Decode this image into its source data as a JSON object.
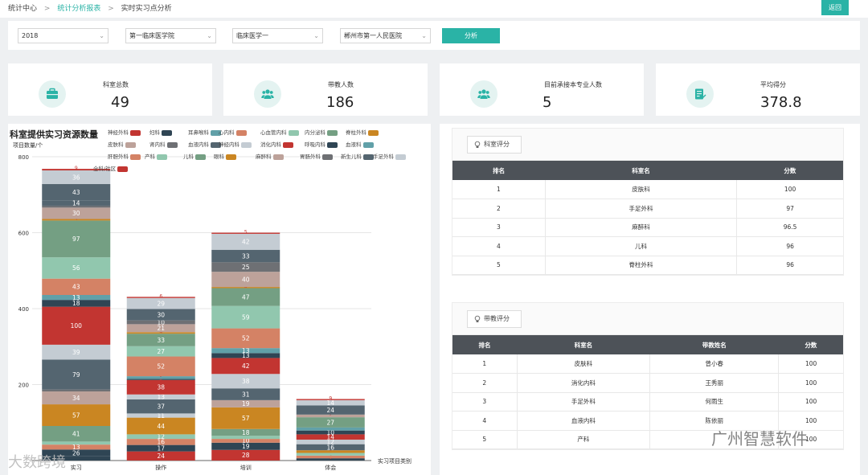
{
  "breadcrumb": [
    "统计中心",
    "统计分析报表",
    "实时实习点分析"
  ],
  "back_label": "返回",
  "filters": {
    "year": "2018",
    "college": "第一临床医学院",
    "major": "临床医学一",
    "hospital": "郴州市第一人民医院",
    "analyze_label": "分析"
  },
  "cards": [
    {
      "label": "科室总数",
      "value": "49",
      "icon": "briefcase-icon"
    },
    {
      "label": "带教人数",
      "value": "186",
      "icon": "group-icon"
    },
    {
      "label": "目前承接本专业人数",
      "value": "5",
      "icon": "group-icon"
    },
    {
      "label": "平均得分",
      "value": "378.8",
      "icon": "score-edit-icon"
    }
  ],
  "chart_data": {
    "type": "bar",
    "stacked": true,
    "title": "科室提供实习资源数量",
    "ylabel": "项目数量/个",
    "xlabel": "实习项目类别",
    "categories": [
      "实习",
      "操作",
      "培训",
      "体会"
    ],
    "ylim": [
      0,
      800
    ],
    "yticks": [
      200,
      400,
      600,
      800
    ],
    "grid": true,
    "legend_position": "top",
    "legend": [
      {
        "name": "神经外科",
        "color": "#c23531"
      },
      {
        "name": "妇科",
        "color": "#2f4554"
      },
      {
        "name": "耳鼻喉科",
        "color": "#61a0a8"
      },
      {
        "name": "心内科",
        "color": "#d48265"
      },
      {
        "name": "心血管内科",
        "color": "#91c7ae"
      },
      {
        "name": "内分泌科",
        "color": "#749f83"
      },
      {
        "name": "脊柱外科",
        "color": "#ca8622"
      },
      {
        "name": "皮肤科",
        "color": "#bda29a"
      },
      {
        "name": "肾内科",
        "color": "#6e7074"
      },
      {
        "name": "血液内科",
        "color": "#546570"
      },
      {
        "name": "神经内科",
        "color": "#c4ccd3"
      },
      {
        "name": "消化内科",
        "color": "#c23531"
      },
      {
        "name": "呼吸内科",
        "color": "#2f4554"
      },
      {
        "name": "血液科",
        "color": "#61a0a8"
      },
      {
        "name": "肝胆外科",
        "color": "#d48265"
      },
      {
        "name": "产科",
        "color": "#91c7ae"
      },
      {
        "name": "儿科",
        "color": "#749f83"
      },
      {
        "name": "眼科",
        "color": "#ca8622"
      },
      {
        "name": "麻醉科",
        "color": "#bda29a"
      },
      {
        "name": "胃肠外科",
        "color": "#6e7074"
      },
      {
        "name": "新生儿科",
        "color": "#546570"
      },
      {
        "name": "手足外科",
        "color": "#c4ccd3"
      },
      {
        "name": "全科/社区",
        "color": "#c23531"
      }
    ],
    "stacks": [
      {
        "category": "实习",
        "segments": [
          {
            "value": 11,
            "color": "#2f4554",
            "label": ""
          },
          {
            "value": 18,
            "color": "#2f4554",
            "label": "26"
          },
          {
            "value": 13,
            "color": "#d48265",
            "label": "13"
          },
          {
            "value": 8,
            "color": "#91c7ae",
            "label": ""
          },
          {
            "value": 41,
            "color": "#749f83",
            "label": "41"
          },
          {
            "value": 57,
            "color": "#ca8622",
            "label": "57"
          },
          {
            "value": 34,
            "color": "#bda29a",
            "label": "34"
          },
          {
            "value": 5,
            "color": "#6e7074",
            "label": ""
          },
          {
            "value": 79,
            "color": "#546570",
            "label": "79"
          },
          {
            "value": 39,
            "color": "#c4ccd3",
            "label": "39"
          },
          {
            "value": 100,
            "color": "#c23531",
            "label": "100"
          },
          {
            "value": 18,
            "color": "#2f4554",
            "label": "18"
          },
          {
            "value": 13,
            "color": "#61a0a8",
            "label": "13"
          },
          {
            "value": 43,
            "color": "#d48265",
            "label": "43"
          },
          {
            "value": 56,
            "color": "#91c7ae",
            "label": "56"
          },
          {
            "value": 97,
            "color": "#749f83",
            "label": "97"
          },
          {
            "value": 4,
            "color": "#ca8622",
            "label": "4"
          },
          {
            "value": 30,
            "color": "#bda29a",
            "label": "30"
          },
          {
            "value": 5,
            "color": "#6e7074",
            "label": ""
          },
          {
            "value": 14,
            "color": "#546570",
            "label": "14"
          },
          {
            "value": 43,
            "color": "#546570",
            "label": "43"
          },
          {
            "value": 36,
            "color": "#c4ccd3",
            "label": "36"
          },
          {
            "value": 4,
            "color": "#c23531",
            "label": "9"
          }
        ]
      },
      {
        "category": "操作",
        "segments": [
          {
            "value": 24,
            "color": "#c23531",
            "label": "24"
          },
          {
            "value": 17,
            "color": "#2f4554",
            "label": "17"
          },
          {
            "value": 16,
            "color": "#d48265",
            "label": "16"
          },
          {
            "value": 12,
            "color": "#91c7ae",
            "label": "12"
          },
          {
            "value": 44,
            "color": "#ca8622",
            "label": "44"
          },
          {
            "value": 11,
            "color": "#c4ccd3",
            "label": "11"
          },
          {
            "value": 37,
            "color": "#546570",
            "label": "37"
          },
          {
            "value": 13,
            "color": "#c4ccd3",
            "label": "13"
          },
          {
            "value": 38,
            "color": "#c23531",
            "label": "38"
          },
          {
            "value": 3,
            "color": "#2f4554",
            "label": "3"
          },
          {
            "value": 7,
            "color": "#61a0a8",
            "label": "7"
          },
          {
            "value": 52,
            "color": "#d48265",
            "label": "52"
          },
          {
            "value": 27,
            "color": "#91c7ae",
            "label": "27"
          },
          {
            "value": 33,
            "color": "#749f83",
            "label": "33"
          },
          {
            "value": 4,
            "color": "#ca8622",
            "label": "4"
          },
          {
            "value": 21,
            "color": "#bda29a",
            "label": "21"
          },
          {
            "value": 10,
            "color": "#6e7074",
            "label": "10"
          },
          {
            "value": 30,
            "color": "#546570",
            "label": "30"
          },
          {
            "value": 29,
            "color": "#c4ccd3",
            "label": "29"
          },
          {
            "value": 3,
            "color": "#c23531",
            "label": "6"
          }
        ]
      },
      {
        "category": "培训",
        "segments": [
          {
            "value": 28,
            "color": "#c23531",
            "label": "28"
          },
          {
            "value": 19,
            "color": "#2f4554",
            "label": "19"
          },
          {
            "value": 10,
            "color": "#d48265",
            "label": "10"
          },
          {
            "value": 8,
            "color": "#91c7ae",
            "label": ""
          },
          {
            "value": 18,
            "color": "#749f83",
            "label": "18"
          },
          {
            "value": 57,
            "color": "#ca8622",
            "label": "57"
          },
          {
            "value": 19,
            "color": "#bda29a",
            "label": "19"
          },
          {
            "value": 31,
            "color": "#546570",
            "label": "31"
          },
          {
            "value": 38,
            "color": "#c4ccd3",
            "label": "38"
          },
          {
            "value": 42,
            "color": "#c23531",
            "label": "42"
          },
          {
            "value": 13,
            "color": "#2f4554",
            "label": "13"
          },
          {
            "value": 13,
            "color": "#61a0a8",
            "label": "13"
          },
          {
            "value": 52,
            "color": "#d48265",
            "label": "52"
          },
          {
            "value": 59,
            "color": "#91c7ae",
            "label": "59"
          },
          {
            "value": 47,
            "color": "#749f83",
            "label": "47"
          },
          {
            "value": 3,
            "color": "#ca8622",
            "label": "3"
          },
          {
            "value": 40,
            "color": "#bda29a",
            "label": "40"
          },
          {
            "value": 25,
            "color": "#6e7074",
            "label": "25"
          },
          {
            "value": 33,
            "color": "#546570",
            "label": "33"
          },
          {
            "value": 42,
            "color": "#c4ccd3",
            "label": "42"
          },
          {
            "value": 3,
            "color": "#c23531",
            "label": "5"
          }
        ]
      },
      {
        "category": "体会",
        "segments": [
          {
            "value": 6,
            "color": "#2f4554",
            "label": "6"
          },
          {
            "value": 7,
            "color": "#d48265",
            "label": ""
          },
          {
            "value": 7,
            "color": "#91c7ae",
            "label": ""
          },
          {
            "value": 7,
            "color": "#ca8622",
            "label": "7"
          },
          {
            "value": 16,
            "color": "#546570",
            "label": "16"
          },
          {
            "value": 12,
            "color": "#c4ccd3",
            "label": "12"
          },
          {
            "value": 14,
            "color": "#c23531",
            "label": "14"
          },
          {
            "value": 10,
            "color": "#2f4554",
            "label": "10"
          },
          {
            "value": 8,
            "color": "#61a0a8",
            "label": ""
          },
          {
            "value": 27,
            "color": "#749f83",
            "label": "27"
          },
          {
            "value": 7,
            "color": "#bda29a",
            "label": "7"
          },
          {
            "value": 24,
            "color": "#546570",
            "label": "24"
          },
          {
            "value": 14,
            "color": "#c4ccd3",
            "label": "14"
          },
          {
            "value": 3,
            "color": "#c23531",
            "label": "9"
          }
        ]
      }
    ]
  },
  "dept_score": {
    "title": "科室评分",
    "headers": [
      "排名",
      "科室名",
      "分数"
    ],
    "rows": [
      [
        "1",
        "皮肤科",
        "100"
      ],
      [
        "2",
        "手足外科",
        "97"
      ],
      [
        "3",
        "麻醉科",
        "96.5"
      ],
      [
        "4",
        "儿科",
        "96"
      ],
      [
        "5",
        "脊柱外科",
        "96"
      ]
    ]
  },
  "teacher_score": {
    "title": "带教评分",
    "headers": [
      "排名",
      "科室名",
      "带教姓名",
      "分数"
    ],
    "rows": [
      [
        "1",
        "皮肤科",
        "曾小春",
        "100"
      ],
      [
        "2",
        "消化内科",
        "王秀丽",
        "100"
      ],
      [
        "3",
        "手足外科",
        "何雨生",
        "100"
      ],
      [
        "4",
        "血液内科",
        "陈依丽",
        "100"
      ],
      [
        "5",
        "产科",
        "",
        "100"
      ]
    ]
  },
  "watermarks": [
    "大数跨境",
    "广州智慧软件"
  ]
}
